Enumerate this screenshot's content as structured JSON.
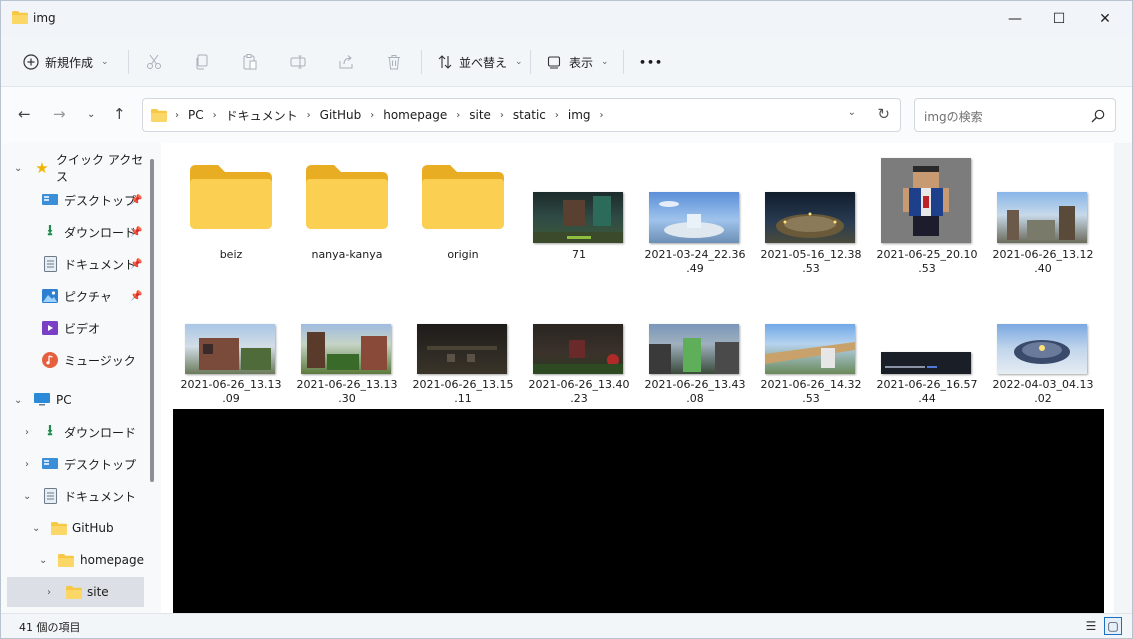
{
  "window": {
    "title": "img",
    "minimize_glyph": "—",
    "maximize_glyph": "☐",
    "close_glyph": "✕"
  },
  "toolbar": {
    "new_label": "新規作成",
    "sort_label": "並べ替え",
    "view_label": "表示",
    "more_label": "•••",
    "icons": [
      "cut-icon",
      "copy-icon",
      "paste-icon",
      "rename-icon",
      "share-icon",
      "delete-icon"
    ]
  },
  "address": {
    "crumbs": [
      "PC",
      "ドキュメント",
      "GitHub",
      "homepage",
      "site",
      "static",
      "img"
    ],
    "search_placeholder": "imgの検索"
  },
  "sidebar": {
    "items": [
      {
        "label": "クイック アクセス",
        "icon": "star-icon"
      },
      {
        "label": "デスクトップ",
        "icon": "desktop-icon"
      },
      {
        "label": "ダウンロード",
        "icon": "download-icon"
      },
      {
        "label": "ドキュメント",
        "icon": "document-icon"
      },
      {
        "label": "ピクチャ",
        "icon": "pictures-icon"
      },
      {
        "label": "ビデオ",
        "icon": "video-icon"
      },
      {
        "label": "ミュージック",
        "icon": "music-icon"
      },
      {
        "label": "PC",
        "icon": "pc-icon"
      },
      {
        "label": "ダウンロード",
        "icon": "download-icon"
      },
      {
        "label": "デスクトップ",
        "icon": "desktop-icon"
      },
      {
        "label": "ドキュメント",
        "icon": "document-icon"
      },
      {
        "label": "GitHub",
        "icon": "folder-icon"
      },
      {
        "label": "homepage",
        "icon": "folder-icon"
      },
      {
        "label": "site",
        "icon": "folder-icon"
      }
    ]
  },
  "files": [
    {
      "name": "beiz",
      "kind": "folder"
    },
    {
      "name": "nanya-kanya",
      "kind": "folder"
    },
    {
      "name": "origin",
      "kind": "folder"
    },
    {
      "name": "71",
      "kind": "image"
    },
    {
      "name": "2021-03-24_22.36\n.49",
      "kind": "image"
    },
    {
      "name": "2021-05-16_12.38\n.53",
      "kind": "image"
    },
    {
      "name": "2021-06-25_20.10\n.53",
      "kind": "image"
    },
    {
      "name": "2021-06-26_13.12\n.40",
      "kind": "image"
    },
    {
      "name": "2021-06-26_13.13\n.09",
      "kind": "image"
    },
    {
      "name": "2021-06-26_13.13\n.30",
      "kind": "image"
    },
    {
      "name": "2021-06-26_13.15\n.11",
      "kind": "image"
    },
    {
      "name": "2021-06-26_13.40\n.23",
      "kind": "image"
    },
    {
      "name": "2021-06-26_13.43\n.08",
      "kind": "image"
    },
    {
      "name": "2021-06-26_14.32\n.53",
      "kind": "image"
    },
    {
      "name": "2021-06-26_16.57\n.44",
      "kind": "image"
    },
    {
      "name": "2022-04-03_04.13\n.02",
      "kind": "image"
    }
  ],
  "status": {
    "item_count": "41 個の項目"
  },
  "colors": {
    "folder": "#f7c846",
    "folder_dark": "#e6a817",
    "accent": "#1b6ec2"
  }
}
